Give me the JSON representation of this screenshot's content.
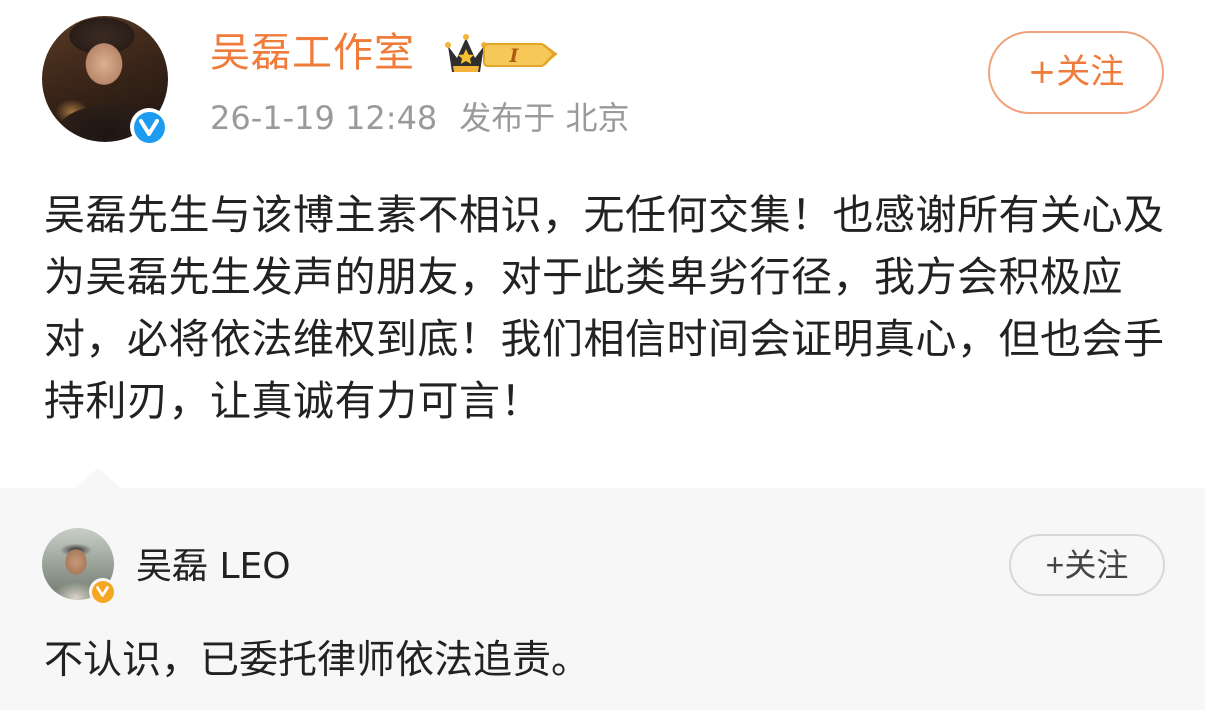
{
  "post": {
    "author_name": "吴磊工作室",
    "vip_level": "I",
    "timestamp": "26-1-19 12:48",
    "location": "发布于 北京",
    "follow_label": "+关注",
    "text": "吴磊先生与该博主素不相识，无任何交集！也感谢所有关心及为吴磊先生发声的朋友，对于此类卑劣行径，我方会积极应对，必将依法维权到底！我们相信时间会证明真心，但也会手持利刃，让真诚有力可言！"
  },
  "quote": {
    "author_name": "吴磊 LEO",
    "follow_label": "+关注",
    "text": "不认识，已委托律师依法追责。"
  },
  "icons": {
    "verified_main": "verified-v-icon",
    "verified_sub": "verified-v-icon",
    "vip_crown": "crown-icon"
  },
  "colors": {
    "name_accent": "#f07c3c",
    "verified_blue": "#1d9bf0",
    "verified_gold": "#f5a623",
    "meta_gray": "#9a9a9a",
    "quote_bg": "#f7f7f7"
  }
}
